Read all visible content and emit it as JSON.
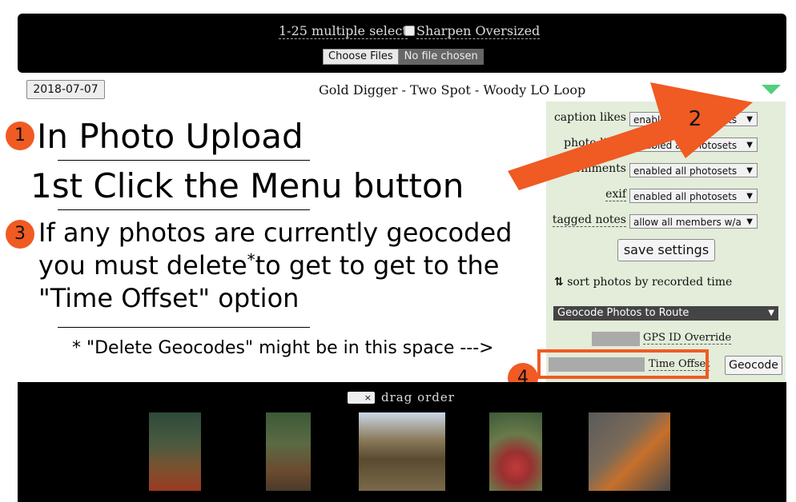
{
  "top_panel": {
    "multi_select_label": "1-25 multiple select",
    "sharpen_label": "Sharpen Oversized",
    "choose_files_label": "Choose Files",
    "no_file_label": "No file chosen"
  },
  "header": {
    "date_button": "2018-07-07",
    "title": "Gold Digger - Two Spot - Woody LO Loop"
  },
  "annotations": {
    "badge1": "1",
    "badge2": "2",
    "badge3": "3",
    "badge4": "4",
    "line1": "In Photo Upload",
    "line2": "1st Click the Menu button",
    "line3a": "If any photos are currently geocoded",
    "line3b_pre": "you must delete",
    "line3b_star": "*",
    "line3b_post": "to get to get to the",
    "line3c": "\"Time Offset\" option",
    "footnote": "* \"Delete Geocodes\" might be in this space --->"
  },
  "settings": {
    "rows": [
      {
        "label": "caption likes",
        "value": "enabled all photosets"
      },
      {
        "label": "photo likes",
        "value": "enabled all photosets"
      },
      {
        "label": "comments",
        "value": "enabled all photosets"
      },
      {
        "label": "exif",
        "value": "enabled all photosets"
      },
      {
        "label": "tagged notes",
        "value": "allow all members w/a"
      }
    ],
    "save_label": "save settings",
    "sort_label": "sort photos by recorded time",
    "geocode_select": "Geocode Photos to Route",
    "gps_label": "GPS ID Override",
    "offset_label": "Time Offset",
    "geocode_button": "Geocode"
  },
  "photos": {
    "drag_label": "drag order",
    "drag_box": "×",
    "items": [
      "forest-trail-photo",
      "bench-photo",
      "shelter-photo",
      "red-rock-photo",
      "ladybugs-photo"
    ]
  },
  "colors": {
    "accent": "#f05a23",
    "panel_green": "#e3edda",
    "menu_triangle": "#4fd07a"
  }
}
